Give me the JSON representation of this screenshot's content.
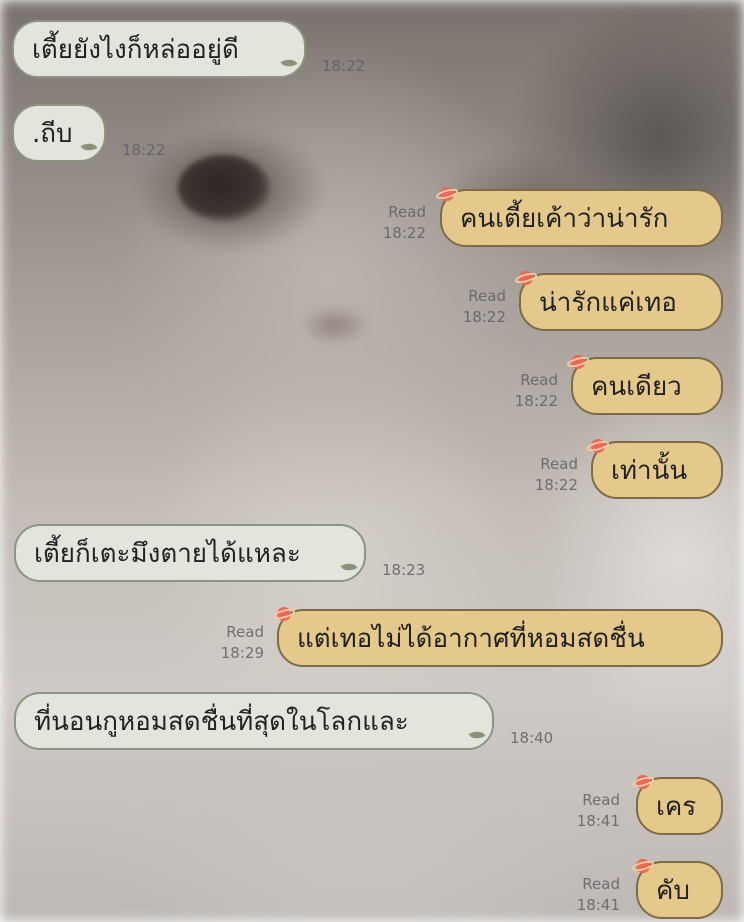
{
  "messages": [
    {
      "side": "in",
      "text": "เตี้ยยังไงก็หล่ออยู่ดี",
      "time": "18:22"
    },
    {
      "side": "in",
      "text": ".ถีบ",
      "time": "18:22"
    },
    {
      "side": "out",
      "text": "คนเตี้ยเค้าว่าน่ารัก",
      "read": "Read",
      "time": "18:22"
    },
    {
      "side": "out",
      "text": "น่ารักแค่เทอ",
      "read": "Read",
      "time": "18:22"
    },
    {
      "side": "out",
      "text": "คนเดียว",
      "read": "Read",
      "time": "18:22"
    },
    {
      "side": "out",
      "text": "เท่านั้น",
      "read": "Read",
      "time": "18:22"
    },
    {
      "side": "in",
      "text": "เตี้ยก็เตะมึงตายได้แหละ",
      "time": "18:23"
    },
    {
      "side": "out",
      "text": "แต่เทอไม่ได้อากาศที่หอมสดชื่น",
      "read": "Read",
      "time": "18:29"
    },
    {
      "side": "in",
      "text": "ที่นอนกูหอมสดชื่นที่สุดในโลกและ",
      "time": "18:40"
    },
    {
      "side": "out",
      "text": "เคร",
      "read": "Read",
      "time": "18:41"
    },
    {
      "side": "out",
      "text": "คับ",
      "read": "Read",
      "time": "18:41"
    }
  ],
  "theme": {
    "incoming_bubble": "#e3e5dc",
    "outgoing_bubble": "#e5c98c",
    "incoming_decoration": "leaf-icon",
    "outgoing_decoration": "planet-icon"
  }
}
